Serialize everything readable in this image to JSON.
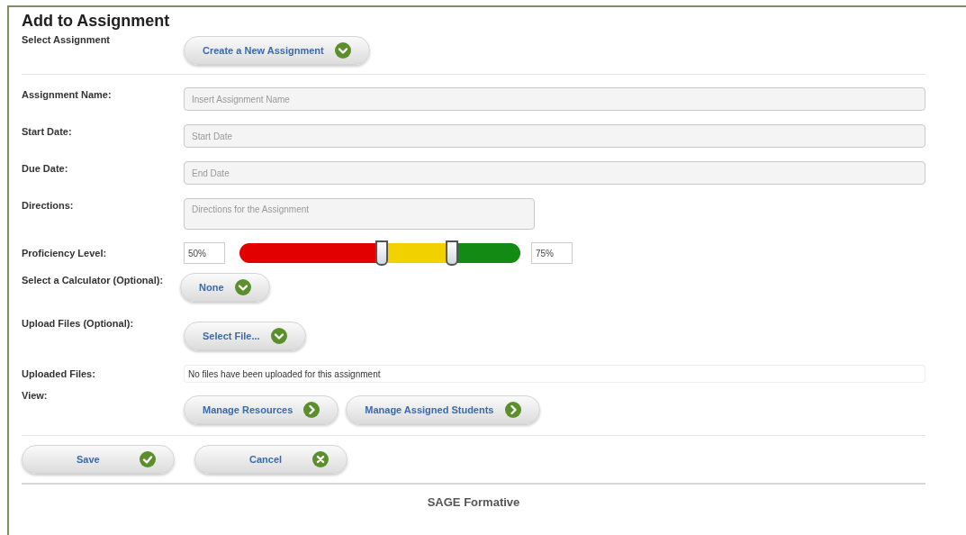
{
  "title": "Add to Assignment",
  "select_assignment": {
    "label": "Select Assignment",
    "button": {
      "label": "Create a New Assignment"
    }
  },
  "fields": [
    {
      "label": "Assignment Name:",
      "placeholder": "Insert Assignment Name",
      "kind": "wide"
    },
    {
      "label": "Start Date:",
      "placeholder": "Start Date",
      "kind": "wide"
    },
    {
      "label": "Due Date:",
      "placeholder": "End Date",
      "kind": "wide"
    },
    {
      "label": "Directions:",
      "placeholder": "Directions for the Assignment",
      "kind": "area"
    }
  ],
  "proficiency": {
    "label": "Proficiency Level:",
    "low": {
      "value": "50%",
      "level": 0.505
    },
    "high": {
      "value": "75%",
      "level": 0.755
    }
  },
  "calculator": {
    "label": "Select a Calculator (Optional):",
    "button": {
      "label": "None"
    }
  },
  "upload": {
    "label": "Upload Files (Optional):",
    "button": {
      "label": "Select File..."
    }
  },
  "uploaded": {
    "label": "Uploaded Files:",
    "text": "No files have been uploaded for this assignment"
  },
  "view": {
    "label": "View:",
    "buttons": [
      {
        "label": "Manage Resources"
      },
      {
        "label": "Manage Assigned Students"
      }
    ]
  },
  "actions": [
    {
      "label": "Save"
    },
    {
      "label": "Cancel"
    }
  ],
  "footer": "SAGE Formative"
}
